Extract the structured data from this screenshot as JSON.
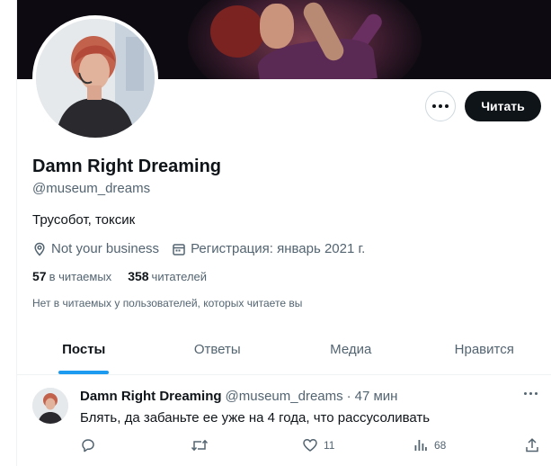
{
  "profile": {
    "name": "Damn Right Dreaming",
    "handle": "@museum_dreams",
    "bio": "Трусобот, токсик",
    "location": "Not your business",
    "joined": "Регистрация: январь 2021 г.",
    "following_count": "57",
    "following_label": "в читаемых",
    "followers_count": "358",
    "followers_label": "читателей",
    "mutuals_note": "Нет в читаемых у пользователей, которых читаете вы"
  },
  "actions": {
    "more_icon": "more-horizontal-icon",
    "follow_label": "Читать"
  },
  "tabs": [
    {
      "label": "Посты",
      "active": true
    },
    {
      "label": "Ответы",
      "active": false
    },
    {
      "label": "Медиа",
      "active": false
    },
    {
      "label": "Нравится",
      "active": false
    }
  ],
  "tweet": {
    "author_name": "Damn Right Dreaming",
    "author_handle": "@museum_dreams",
    "separator": "·",
    "time": "47 мин",
    "text": "Блять, да забаньте ее уже на 4 года, что рассусоливать",
    "reply_count": "",
    "retweet_count": "",
    "like_count": "11",
    "view_count": "68"
  },
  "colors": {
    "accent": "#1d9bf0",
    "text_primary": "#0f1419",
    "text_secondary": "#536471",
    "button_dark": "#0f1419"
  }
}
